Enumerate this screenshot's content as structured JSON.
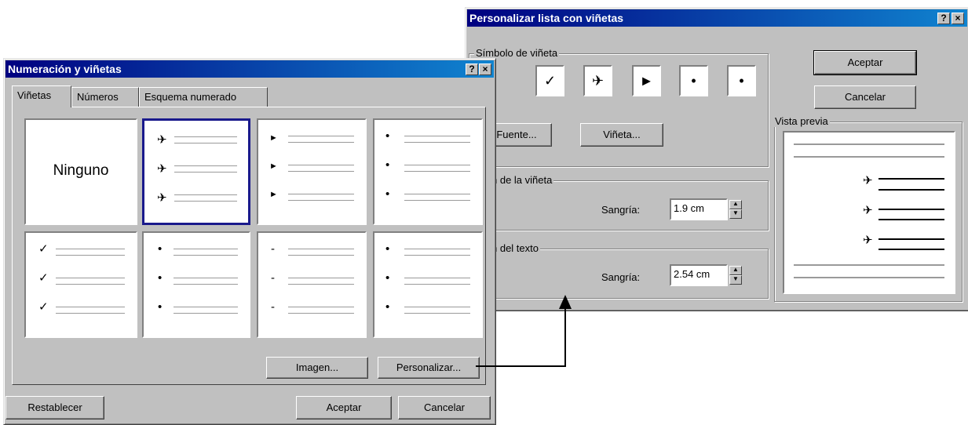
{
  "dialog_main": {
    "title": "Numeración y viñetas",
    "tabs": [
      "Viñetas",
      "Números",
      "Esquema numerado"
    ],
    "none_label": "Ninguno",
    "image_button": "Imagen...",
    "customize_button": "Personalizar...",
    "reset_button": "Restablecer",
    "ok_button": "Aceptar",
    "cancel_button": "Cancelar"
  },
  "dialog_custom": {
    "title": "Personalizar lista con viñetas",
    "symbol_group": "Símbolo de viñeta",
    "symbols": [
      "✈",
      "✓",
      "✈",
      "►",
      "•",
      "•"
    ],
    "font_button": "Fuente...",
    "bullet_button": "Viñeta...",
    "bullet_position_group": "sición de la viñeta",
    "bullet_indent_label": "Sangría:",
    "bullet_indent_value": "1.9 cm",
    "text_position_group": "sición del texto",
    "text_indent_label": "Sangría:",
    "text_indent_value": "2.54 cm",
    "preview_group": "Vista previa",
    "ok_button": "Aceptar",
    "cancel_button": "Cancelar"
  },
  "title_buttons": {
    "help": "?",
    "close": "×"
  },
  "colors": {
    "titlebar_start": "#000080",
    "titlebar_end": "#1084d0",
    "face": "#c0c0c0",
    "selection_border": "#1a1a8c"
  },
  "icons": [
    "help-icon",
    "close-icon",
    "plane-bullet-icon",
    "check-bullet-icon",
    "arrow-bullet-icon",
    "dot-bullet-icon",
    "dash-bullet-icon",
    "arrow-connector"
  ]
}
